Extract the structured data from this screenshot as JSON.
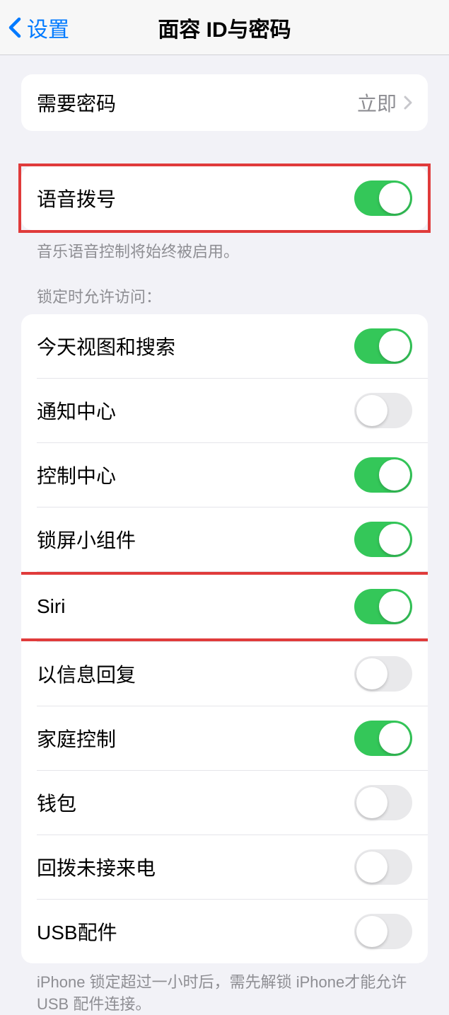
{
  "nav": {
    "back_label": "设置",
    "title": "面容 ID与密码"
  },
  "require_passcode": {
    "label": "需要密码",
    "value": "立即"
  },
  "voice_dial": {
    "label": "语音拨号",
    "on": true,
    "footer": "音乐语音控制将始终被启用。"
  },
  "locked_access": {
    "header": "锁定时允许访问：",
    "items": [
      {
        "label": "今天视图和搜索",
        "on": true
      },
      {
        "label": "通知中心",
        "on": false
      },
      {
        "label": "控制中心",
        "on": true
      },
      {
        "label": "锁屏小组件",
        "on": true
      },
      {
        "label": "Siri",
        "on": true
      },
      {
        "label": "以信息回复",
        "on": false
      },
      {
        "label": "家庭控制",
        "on": true
      },
      {
        "label": "钱包",
        "on": false
      },
      {
        "label": "回拨未接来电",
        "on": false
      },
      {
        "label": "USB配件",
        "on": false
      }
    ],
    "footer": "iPhone 锁定超过一小时后，需先解锁 iPhone才能允许USB 配件连接。"
  }
}
